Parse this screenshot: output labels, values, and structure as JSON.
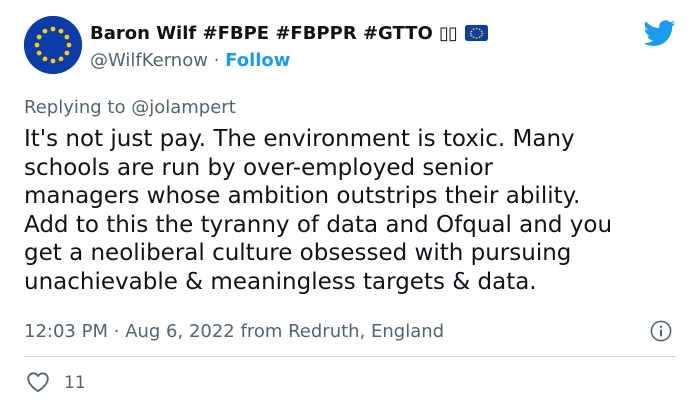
{
  "author": {
    "display_name": "Baron Wilf #FBPE #FBPPR #GTTO",
    "name_glyphs": "▯▯",
    "handle": "@WilfKernow",
    "separator": "·",
    "follow_label": "Follow",
    "avatar": "eu-flag-avatar"
  },
  "brand_icon": "twitter-bird-icon",
  "reply": {
    "label": "Replying to",
    "target": "@jolampert"
  },
  "body_lines": [
    "It's not just pay. The environment is toxic. Many",
    "schools are run by over-employed senior",
    "managers whose ambition outstrips their ability.",
    "Add to this the tyranny of data and Ofqual and you",
    "get a neoliberal culture obsessed with pursuing",
    "unachievable & meaningless targets & data."
  ],
  "meta": {
    "time": "12:03 PM",
    "separator": "·",
    "date": "Aug 6, 2022",
    "location": "from Redruth, England"
  },
  "actions": {
    "like_icon": "heart-icon",
    "like_count": "11",
    "info_icon": "info-icon"
  },
  "colors": {
    "text": "#0f1419",
    "secondary": "#536471",
    "accent": "#1d9bf0",
    "divider": "#cfd9de",
    "eu_blue": "#0a3da8",
    "eu_gold": "#ffcc00"
  }
}
